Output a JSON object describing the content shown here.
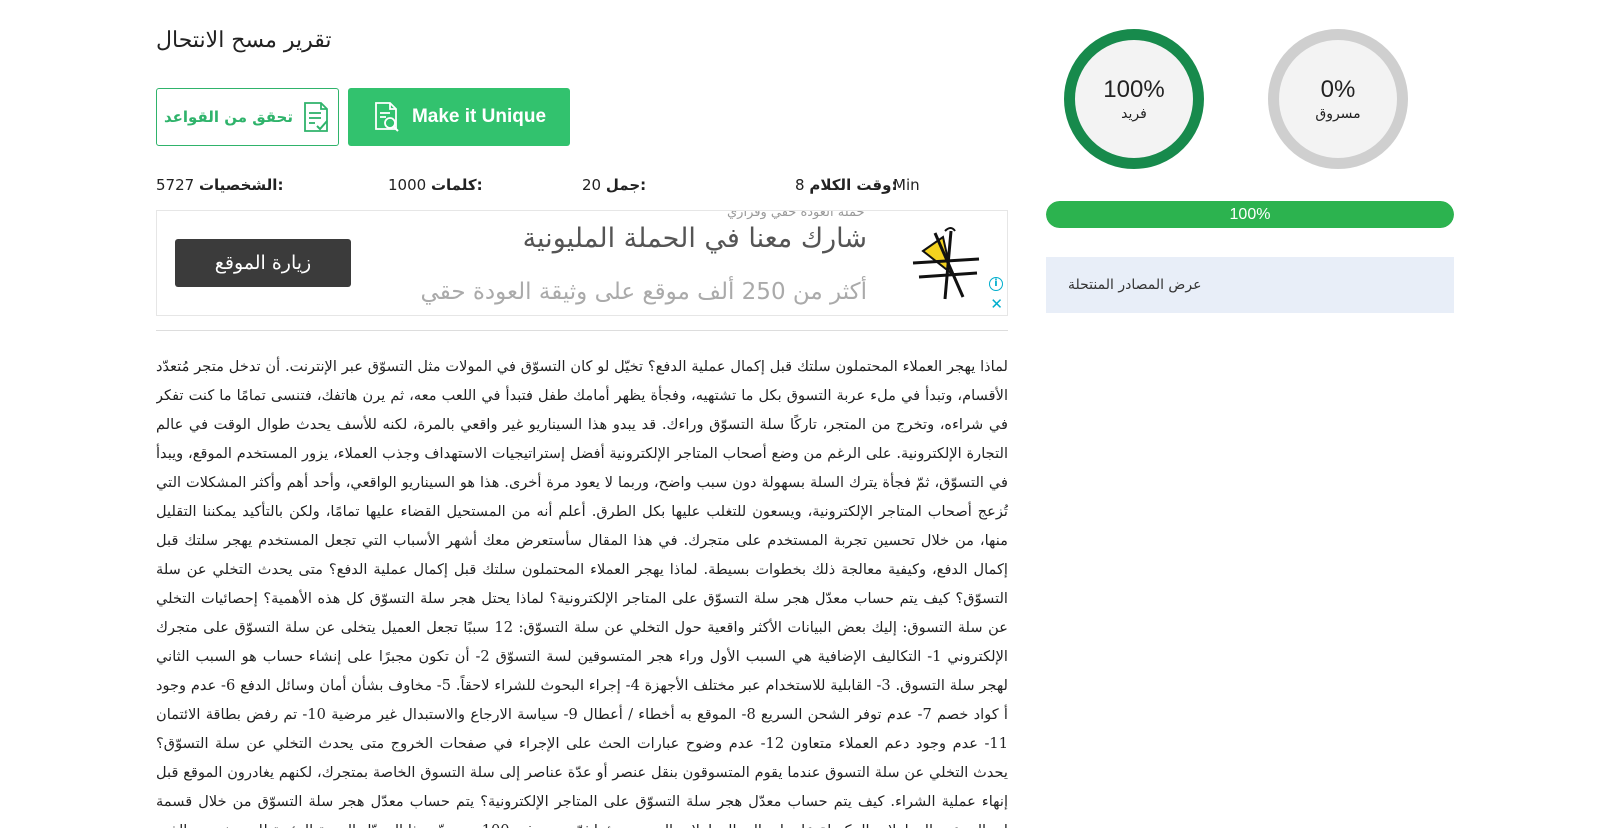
{
  "report": {
    "title": "تقرير مسح الانتحال",
    "buttons": {
      "check_rules": "تحقق من القواعد",
      "make_unique": "Make it Unique"
    },
    "stats": {
      "time_label": "وقت الكلام:",
      "time_value": "8",
      "time_unit": "Min",
      "sentences_label": "جمل:",
      "sentences_value": "20",
      "words_label": "كلمات:",
      "words_value": "1000",
      "chars_label": "الشخصيات:",
      "chars_value": "5727"
    }
  },
  "ad": {
    "sub": "حملة العودة حقي وقراري",
    "headline": "شارك معنا في الحملة المليونية",
    "body": "أكثر من 250 ألف موقع على وثيقة العودة حقي",
    "button": "زيارة الموقع",
    "info_glyph": "i",
    "close_glyph": "✕",
    "icon": "campaign-logo-icon"
  },
  "article": {
    "text": "لماذا يهجر العملاء المحتملون سلتك قبل إكمال عملية الدفع؟ تخيّل لو كان التسوّق في المولات مثل التسوّق عبر الإنترنت. أن تدخل متجر مُتعدّد الأقسام، وتبدأ في ملء عربة التسوق بكل ما تشتهيه، وفجأة يظهر أمامك طفل فتبدأ في اللعب معه، ثم يرن هاتفك، فتنسى تمامًا ما كنت تفكر في شراءه، وتخرج من المتجر، تاركًا سلة التسوّق وراءك. قد يبدو هذا السيناريو غير واقعي بالمرة، لكنه للأسف يحدث طوال الوقت في عالم التجارة الإلكترونية. على الرغم من وضع أصحاب المتاجر الإلكترونية أفضل إستراتيجيات الاستهداف وجذب العملاء، يزور المستخدم الموقع، ويبدأ في التسوّق، ثمّ فجأة يترك السلة بسهولة دون سبب واضح، وربما لا يعود مرة أخرى. هذا هو السيناريو الواقعي، وأحد أهم وأكثر المشكلات التي تُزعج أصحاب المتاجر الإلكترونية، ويسعون للتغلب عليها بكل الطرق. أعلم أنه من المستحيل القضاء عليها تمامًا، ولكن بالتأكيد يمكننا التقليل منها، من خلال تحسين تجربة المستخدم على متجرك. في هذا المقال سأستعرض معك أشهر الأسباب التي تجعل المستخدم يهجر سلتك قبل إكمال الدفع، وكيفية معالجة ذلك بخطوات بسيطة. لماذا يهجر العملاء المحتملون سلتك قبل إكمال عملية الدفع؟ متى يحدث التخلي عن سلة التسوّق؟ كيف يتم حساب معدّل هجر سلة التسوّق على المتاجر الإلكترونية؟ لماذا يحتل هجر سلة التسوّق كل هذه الأهمية؟ إحصائيات التخلي عن سلة التسوق: إليك بعض البيانات الأكثر واقعية حول التخلي عن سلة التسوّق: 12 سببًا تجعل العميل يتخلى عن سلة التسوّق على متجرك الإلكتروني 1- التكاليف الإضافية هي السبب الأول وراء هجر المتسوقين لسة التسوّق 2- أن تكون مجبرًا على إنشاء حساب هو السبب الثاني لهجر سلة التسوق. 3- القابلية للاستخدام عبر مختلف الأجهزة 4- إجراء البحوث للشراء لاحقاً. 5- مخاوف بشأن أمان وسائل الدفع 6- عدم وجود أ كواد خصم 7- عدم توفر الشحن السريع 8- الموقع به أخطاء / أعطال 9- سياسة الارجاع والاستبدال غير مرضية 10- تم رفض بطاقة الائتمان 11- عدم وجود دعم العملاء متعاون 12- عدم وضوح عبارات الحث على الإجراء في صفحات الخروج متى يحدث التخلي عن سلة التسوّق؟ يحدث التخلي عن سلة التسوق عندما يقوم المتسوقون بنقل عنصر أو عدّة عناصر إلى سلة التسوق الخاصة بمتجرك، لكنهم يغادرون الموقع قبل إنهاء عملية الشراء. كيف يتم حساب معدّل هجر سلة التسوّق على المتاجر الإلكترونية؟ يتم حساب معدّل هجر سلة التسوّق من خلال قسمة إجمالي عدد المعاملات المكتملة على إجمالي المعاملات التي تم بدؤها ثمّ ضربه في 100، سيحدّد هذا المعدّل النسبة المئوية للمستخدمين الذين لديهم نية الشراء،"
  },
  "results": {
    "unique_pct": "100%",
    "unique_label": "فريد",
    "plagiarized_pct": "0%",
    "plagiarized_label": "مسروق",
    "progress": 1.0,
    "progress_text": "100%",
    "sources_link": "عرض المصادر المنتحلة",
    "colors": {
      "unique_ring": "#178a4c",
      "plag_ring": "#cfcfcf",
      "progress": "#2cb34f",
      "button_green": "#32c26e"
    }
  }
}
